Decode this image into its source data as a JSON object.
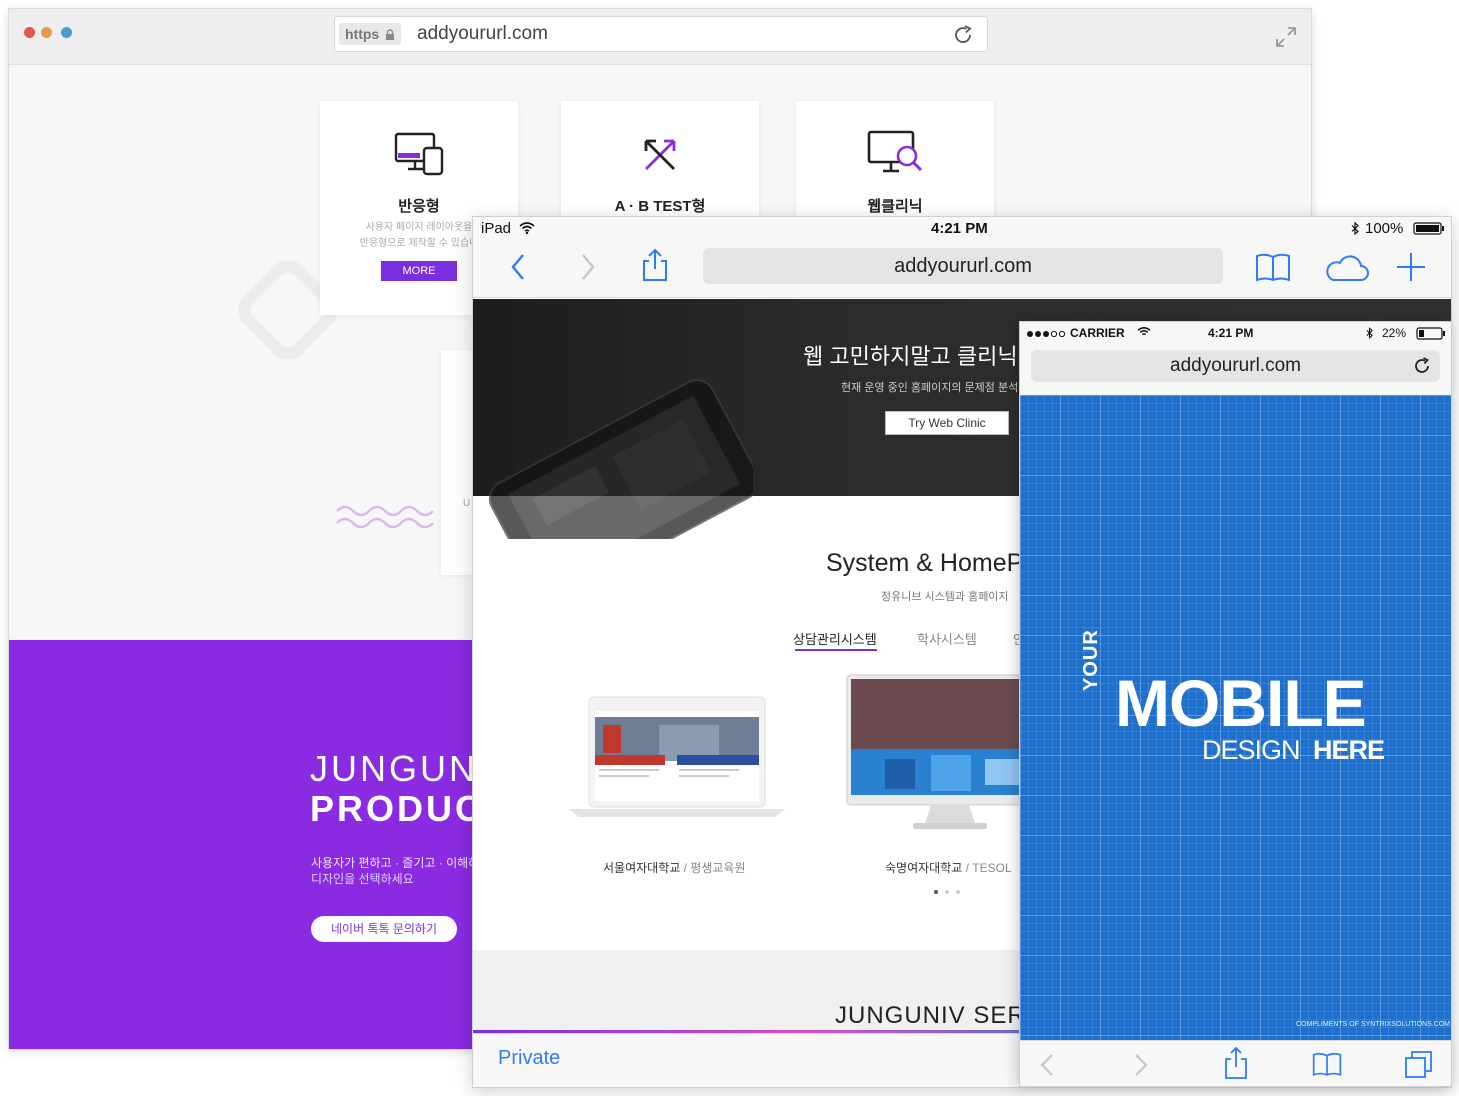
{
  "desktop": {
    "url_scheme": "https",
    "url": "addyoururl.com",
    "cards": [
      {
        "title": "반응형",
        "desc1": "사용자 페이지 레이아웃을",
        "desc2": "반응형으로 제작할 수 있습니",
        "more_label": "MORE"
      },
      {
        "title": "A · B TEST형"
      },
      {
        "title": "웹클리닉"
      }
    ],
    "card_partial_text": "U",
    "promo": {
      "title_line1": "JUNGUNI",
      "title_line2": "PRODUC",
      "desc1": "사용자가 편하고 · 즐기고 · 이해하",
      "desc2": "디자인을 선택하세요",
      "button_label": "네이버 톡톡 문의하기"
    },
    "colors": {
      "accent": "#8a2be2",
      "button": "#7b2fe0"
    }
  },
  "ipad": {
    "carrier": "iPad",
    "time": "4:21 PM",
    "battery": "100%",
    "url": "addyoururl.com",
    "hero": {
      "title": "웹 고민하지말고 클리닉",
      "subtitle": "현재 운영 중인 홈페이지의 문제점 분석",
      "button_label": "Try Web Clinic"
    },
    "section": {
      "title": "System & HomeP",
      "subtitle": "정유니브 시스템과 홈페이지",
      "tabs": [
        "상담관리시스템",
        "학사시스템",
        "안"
      ],
      "active_tab": 0,
      "portfolio": [
        {
          "name": "서울여자대학교",
          "sub": "/ 평생교육원"
        },
        {
          "name": "숙명여자대학교",
          "sub": "/ TESOL"
        }
      ]
    },
    "services_title": "JUNGUNIV SERV",
    "private_label": "Private"
  },
  "iphone": {
    "carrier": "CARRIER",
    "time": "4:21 PM",
    "battery": "22%",
    "url": "addyoururl.com",
    "poster": {
      "your": "YOUR",
      "mobile": "MOBILE",
      "design": "DESIGN",
      "here": "HERE",
      "compliments": "COMPLIMENTS OF  SYNTRIXSOLUTIONS.COM"
    },
    "colors": {
      "poster_bg": "#1f6fcc"
    }
  },
  "icons": [
    "lock-icon",
    "reload-icon",
    "expand-icon",
    "responsive-device-icon",
    "ab-test-arrows-icon",
    "web-clinic-magnifier-icon",
    "back-icon",
    "forward-icon",
    "share-icon",
    "bookmarks-icon",
    "cloud-icon",
    "add-tab-icon",
    "tabs-icon",
    "wifi-icon",
    "bluetooth-icon",
    "battery-icon"
  ]
}
